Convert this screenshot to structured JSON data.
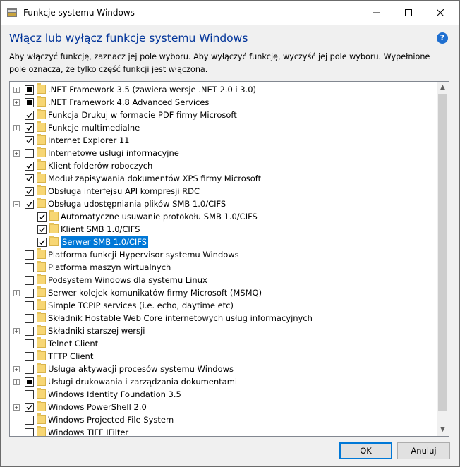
{
  "window": {
    "title": "Funkcje systemu Windows",
    "heading": "Włącz lub wyłącz funkcje systemu Windows",
    "description": "Aby włączyć funkcję, zaznacz jej pole wyboru. Aby wyłączyć funkcję, wyczyść jej pole wyboru. Wypełnione pole oznacza, że tylko część funkcji jest włączona.",
    "help_label": "?"
  },
  "features": [
    {
      "label": ".NET Framework 3.5 (zawiera wersje .NET 2.0 i 3.0)",
      "state": "partial",
      "expander": "+",
      "level": 0
    },
    {
      "label": ".NET Framework 4.8 Advanced Services",
      "state": "partial",
      "expander": "+",
      "level": 0
    },
    {
      "label": "Funkcja Drukuj w formacie PDF firmy Microsoft",
      "state": "checked",
      "expander": "",
      "level": 0
    },
    {
      "label": "Funkcje multimedialne",
      "state": "checked",
      "expander": "+",
      "level": 0
    },
    {
      "label": "Internet Explorer 11",
      "state": "checked",
      "expander": "",
      "level": 0
    },
    {
      "label": "Internetowe usługi informacyjne",
      "state": "unchecked",
      "expander": "+",
      "level": 0
    },
    {
      "label": "Klient folderów roboczych",
      "state": "checked",
      "expander": "",
      "level": 0
    },
    {
      "label": "Moduł zapisywania dokumentów XPS firmy Microsoft",
      "state": "checked",
      "expander": "",
      "level": 0
    },
    {
      "label": "Obsługa interfejsu API kompresji RDC",
      "state": "checked",
      "expander": "",
      "level": 0
    },
    {
      "label": "Obsługa udostępniania plików SMB 1.0/CIFS",
      "state": "checked",
      "expander": "−",
      "level": 0
    },
    {
      "label": "Automatyczne usuwanie protokołu SMB 1.0/CIFS",
      "state": "checked",
      "expander": "",
      "level": 1
    },
    {
      "label": "Klient SMB 1.0/CIFS",
      "state": "checked",
      "expander": "",
      "level": 1
    },
    {
      "label": "Serwer SMB 1.0/CIFS",
      "state": "checked",
      "expander": "",
      "level": 1,
      "selected": true
    },
    {
      "label": "Platforma funkcji Hypervisor systemu Windows",
      "state": "unchecked",
      "expander": "",
      "level": 0
    },
    {
      "label": "Platforma maszyn wirtualnych",
      "state": "unchecked",
      "expander": "",
      "level": 0
    },
    {
      "label": "Podsystem Windows dla systemu Linux",
      "state": "unchecked",
      "expander": "",
      "level": 0
    },
    {
      "label": "Serwer kolejek komunikatów firmy Microsoft (MSMQ)",
      "state": "unchecked",
      "expander": "+",
      "level": 0
    },
    {
      "label": "Simple TCPIP services (i.e. echo, daytime etc)",
      "state": "unchecked",
      "expander": "",
      "level": 0
    },
    {
      "label": "Składnik Hostable Web Core internetowych usług informacyjnych",
      "state": "unchecked",
      "expander": "",
      "level": 0
    },
    {
      "label": "Składniki starszej wersji",
      "state": "unchecked",
      "expander": "+",
      "level": 0
    },
    {
      "label": "Telnet Client",
      "state": "unchecked",
      "expander": "",
      "level": 0
    },
    {
      "label": "TFTP Client",
      "state": "unchecked",
      "expander": "",
      "level": 0
    },
    {
      "label": "Usługa aktywacji procesów systemu Windows",
      "state": "unchecked",
      "expander": "+",
      "level": 0
    },
    {
      "label": "Usługi drukowania i zarządzania dokumentami",
      "state": "partial",
      "expander": "+",
      "level": 0
    },
    {
      "label": "Windows Identity Foundation 3.5",
      "state": "unchecked",
      "expander": "",
      "level": 0
    },
    {
      "label": "Windows PowerShell 2.0",
      "state": "checked",
      "expander": "+",
      "level": 0
    },
    {
      "label": "Windows Projected File System",
      "state": "unchecked",
      "expander": "",
      "level": 0
    },
    {
      "label": "Windows TIFF IFilter",
      "state": "unchecked",
      "expander": "",
      "level": 0
    }
  ],
  "buttons": {
    "ok": "OK",
    "cancel": "Anuluj"
  },
  "colors": {
    "heading": "#003399",
    "selection": "#0078d7",
    "folder": "#f7d674"
  }
}
